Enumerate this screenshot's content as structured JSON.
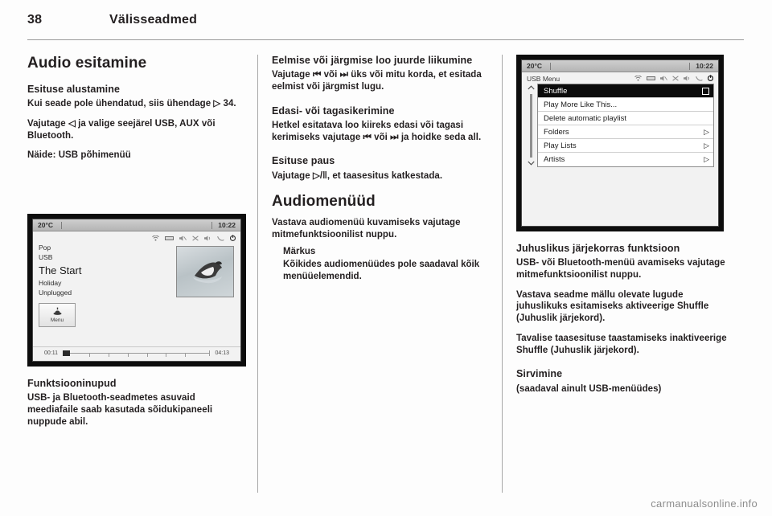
{
  "header": {
    "page_number": "38",
    "title": "Välisseadmed"
  },
  "column1": {
    "section_title": "Audio esitamine",
    "sub1_title": "Esituse alustamine",
    "sub1_p1": "Kui seade pole ühendatud, siis ühendage ▷ 34.",
    "sub1_p2": "Vajutage ◁ ja valige seejärel USB, AUX või Bluetooth.",
    "sub1_p3": "Näide: USB põhimenüü",
    "sub2_title": "Funktsiooninupud",
    "sub2_p1": "USB- ja Bluetooth-seadmetes asuvaid meediafaile saab kasutada sõidukipaneeli nuppude abil.",
    "screenshot": {
      "temperature": "20°C",
      "clock": "10:22",
      "genre": "Pop",
      "source": "USB",
      "track_title": "The Start",
      "album": "Holiday",
      "extra": "Unplugged",
      "menu_button_label": "Menu",
      "elapsed_time": "00:11",
      "total_time": "04:13"
    }
  },
  "column2": {
    "sub1_title": "Eelmise või järgmise loo juurde liikumine",
    "sub1_p1": "Vajutage ⏮ või ⏭ üks või mitu korda, et esitada eelmist või järgmist lugu.",
    "sub2_title": "Edasi- või tagasikerimine",
    "sub2_p1": "Hetkel esitatava loo kiireks edasi või tagasi kerimiseks vajutage ⏮ või ⏭ ja hoidke seda all.",
    "sub3_title": "Esituse paus",
    "sub3_p1": "Vajutage ▷/‖, et taasesitus katkestada.",
    "sub4_title": "Audiomenüüd",
    "sub4_p1": "Vastava audiomenüü kuvamiseks vajutage mitmefunktsioonilist nuppu.",
    "note_title": "Märkus",
    "note_body": "Kõikides audiomenüüdes pole saadaval kõik menüüelemendid."
  },
  "column3": {
    "sub1_title": "Juhuslikus järjekorras funktsioon",
    "sub1_p1": "USB- või Bluetooth-menüü avamiseks vajutage mitmefunktsioonilist nuppu.",
    "sub1_p2": "Vastava seadme mällu olevate lugude juhuslikuks esitamiseks aktiveerige Shuffle (Juhuslik järjekord).",
    "sub1_p3": "Tavalise taasesituse taastamiseks inaktiveerige Shuffle (Juhuslik järjekord).",
    "sub2_title": "Sirvimine",
    "sub2_p1": "(saadaval ainult USB-menüüdes)",
    "screenshot": {
      "temperature": "20°C",
      "clock": "10:22",
      "menu_title": "USB Menu",
      "items": [
        {
          "label": "Shuffle",
          "selected": true,
          "control": "checkbox"
        },
        {
          "label": "Play More Like This...",
          "selected": false,
          "control": "none"
        },
        {
          "label": "Delete automatic playlist",
          "selected": false,
          "control": "none"
        },
        {
          "label": "Folders",
          "selected": false,
          "control": "arrow"
        },
        {
          "label": "Play Lists",
          "selected": false,
          "control": "arrow"
        },
        {
          "label": "Artists",
          "selected": false,
          "control": "arrow"
        }
      ]
    }
  },
  "watermark": "carmanualsonline.info"
}
